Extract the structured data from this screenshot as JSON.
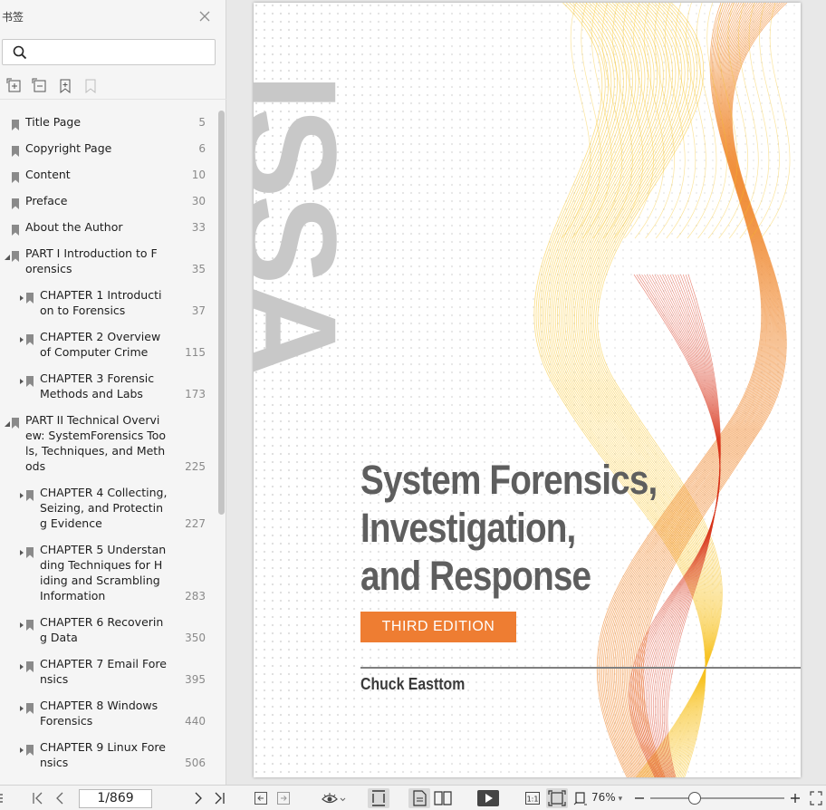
{
  "sidebar": {
    "title": "书签",
    "search": {
      "placeholder": "",
      "value": ""
    },
    "outline": [
      {
        "label": "Title Page",
        "page": "5",
        "level": 0,
        "expandable": false
      },
      {
        "label": "Copyright Page",
        "page": "6",
        "level": 0,
        "expandable": false
      },
      {
        "label": "Content",
        "page": "10",
        "level": 0,
        "expandable": false
      },
      {
        "label": "Preface",
        "page": "30",
        "level": 0,
        "expandable": false
      },
      {
        "label": "About the Author",
        "page": "33",
        "level": 0,
        "expandable": false
      },
      {
        "label": "PART I Introduction to F\norensics",
        "page": "35",
        "level": 0,
        "expandable": true,
        "expanded": true
      },
      {
        "label": "CHAPTER 1 Introducti\non to Forensics",
        "page": "37",
        "level": 1,
        "expandable": true,
        "expanded": false
      },
      {
        "label": "CHAPTER 2 Overview\nof Computer Crime",
        "page": "115",
        "level": 1,
        "expandable": true,
        "expanded": false
      },
      {
        "label": "CHAPTER 3 Forensic\nMethods and Labs",
        "page": "173",
        "level": 1,
        "expandable": true,
        "expanded": false
      },
      {
        "label": "PART II Technical Overvi\new: SystemForensics Too\nls, Techniques, and Meth\nods",
        "page": "225",
        "level": 0,
        "expandable": true,
        "expanded": true
      },
      {
        "label": "CHAPTER 4 Collecting,\nSeizing, and Protectin\ng Evidence",
        "page": "227",
        "level": 1,
        "expandable": true,
        "expanded": false
      },
      {
        "label": "CHAPTER 5 Understan\nding Techniques for H\niding and Scrambling\nInformation",
        "page": "283",
        "level": 1,
        "expandable": true,
        "expanded": false
      },
      {
        "label": "CHAPTER 6 Recoverin\ng Data",
        "page": "350",
        "level": 1,
        "expandable": true,
        "expanded": false
      },
      {
        "label": "CHAPTER 7 Email Fore\nnsics",
        "page": "395",
        "level": 1,
        "expandable": true,
        "expanded": false
      },
      {
        "label": "CHAPTER 8 Windows\nForensics",
        "page": "440",
        "level": 1,
        "expandable": true,
        "expanded": false
      },
      {
        "label": "CHAPTER 9 Linux Fore\nnsics",
        "page": "506",
        "level": 1,
        "expandable": true,
        "expanded": false
      }
    ]
  },
  "cover": {
    "series_mark": "ISSA",
    "title": "System Forensics,\nInvestigation,\nand Response",
    "edition": "THIRD EDITION",
    "author": "Chuck Easttom"
  },
  "statusbar": {
    "page_indicator": "1/869",
    "zoom": "76%",
    "zoom_level": 0.33
  },
  "colors": {
    "edition_badge": "#ee7d32",
    "title_text": "#5e5e5e",
    "ribbon_yellow": "#f7c323",
    "ribbon_orange": "#ef7d1a",
    "ribbon_red": "#d8341c"
  }
}
